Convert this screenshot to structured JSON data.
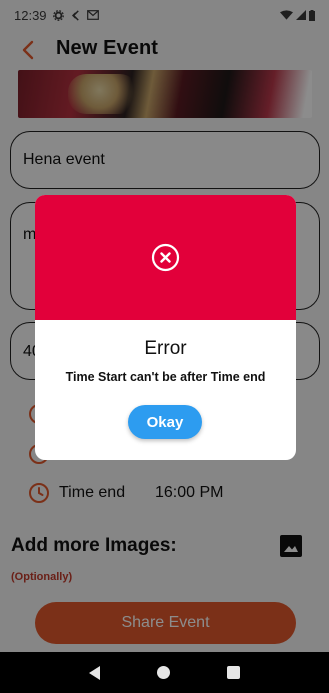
{
  "status_bar": {
    "time": "12:39",
    "icons_left": [
      "gear-icon",
      "speed-icon",
      "mail-icon"
    ],
    "icons_right": [
      "wifi-icon",
      "signal-icon",
      "battery-icon"
    ]
  },
  "app_bar": {
    "title": "New Event",
    "back_icon": "chevron-left-icon"
  },
  "form": {
    "event_name": "Hena event",
    "description_partial": "m",
    "price_partial": "40",
    "time_end_label": "Time end",
    "time_end_value": "16:00 PM"
  },
  "images_section": {
    "title": "Add more Images:",
    "optional_label": "(Optionally)",
    "icon": "image-icon"
  },
  "share_button": {
    "label": "Share Event"
  },
  "dialog": {
    "title": "Error",
    "message": "Time Start can't be after Time end",
    "button_label": "Okay",
    "icon": "close-circle-icon",
    "header_color": "#e2003a",
    "button_color": "#2d9cf0"
  },
  "colors": {
    "accent": "#e0582c",
    "error": "#e2003a",
    "optional_text": "#c23a2b"
  }
}
